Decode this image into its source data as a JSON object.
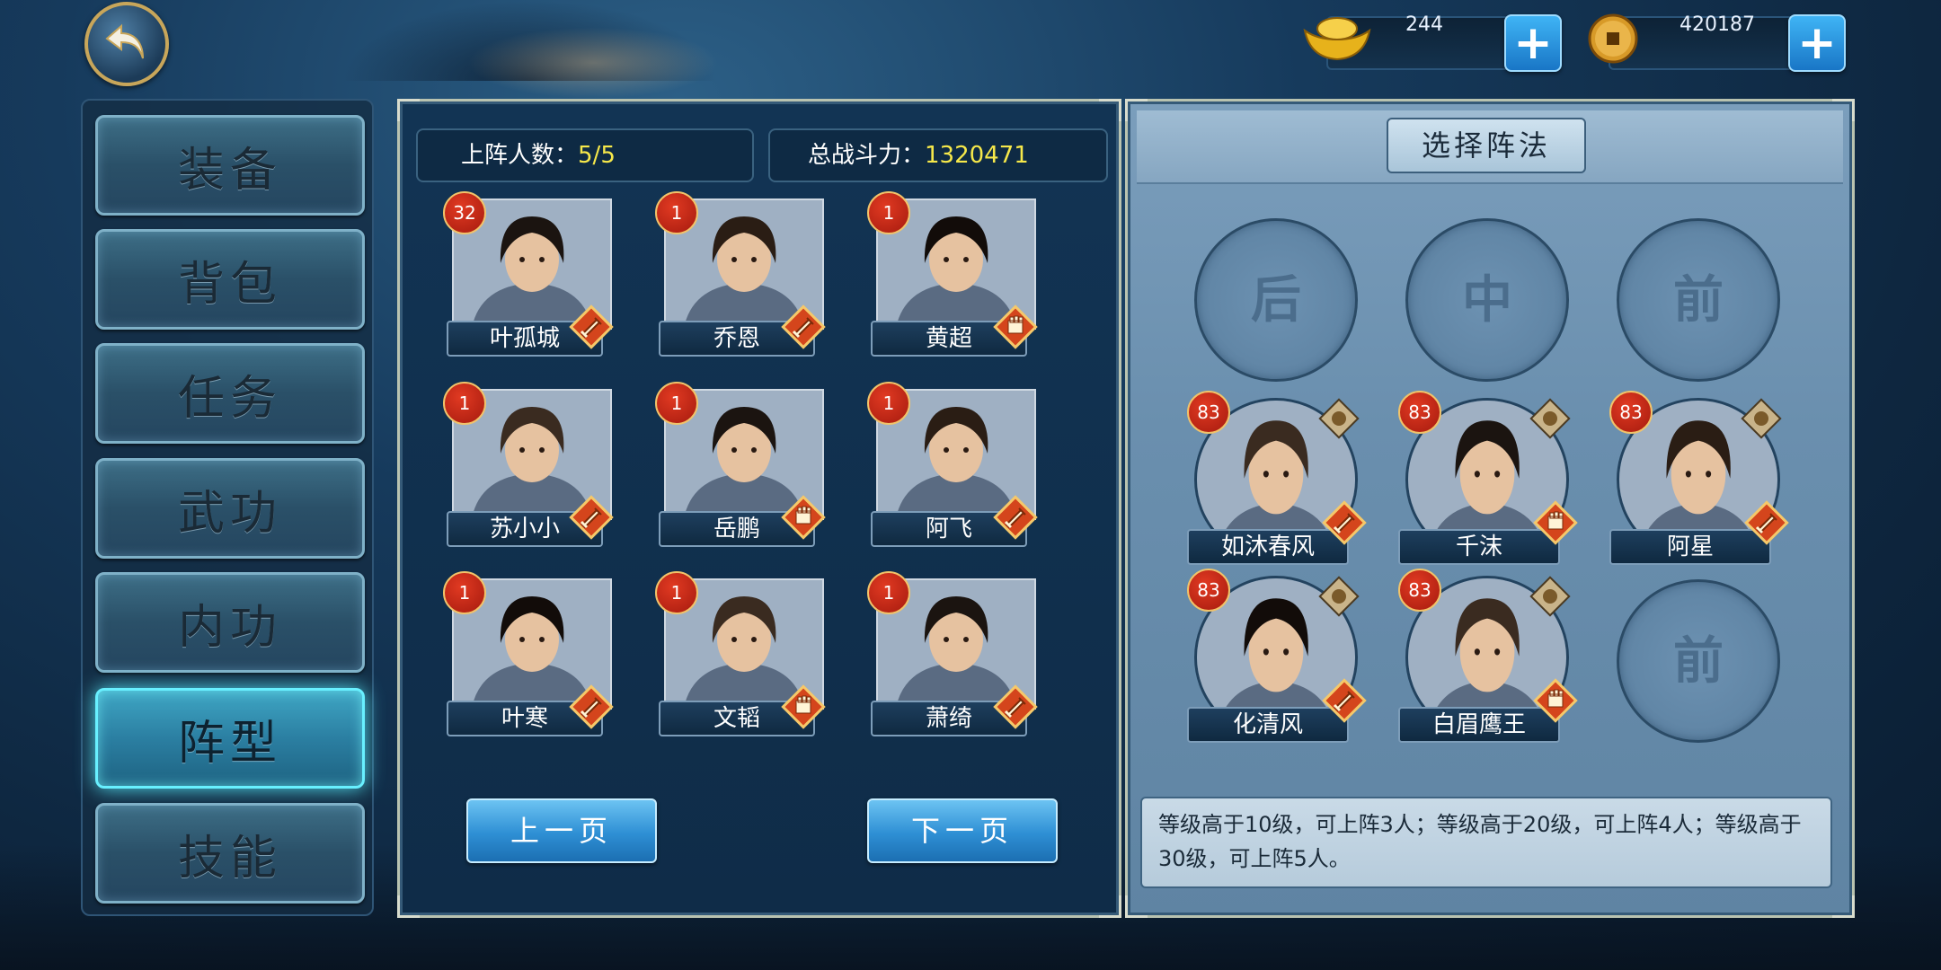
{
  "currency": {
    "gold": "244",
    "copper": "420187"
  },
  "menu": [
    {
      "label": "装备",
      "active": false
    },
    {
      "label": "背包",
      "active": false
    },
    {
      "label": "任务",
      "active": false
    },
    {
      "label": "武功",
      "active": false
    },
    {
      "label": "内功",
      "active": false
    },
    {
      "label": "阵型",
      "active": true
    },
    {
      "label": "技能",
      "active": false
    }
  ],
  "roster": {
    "deployed_label": "上阵人数：",
    "deployed_value": "5/5",
    "power_label": "总战斗力：",
    "power_value": "1320471",
    "heroes": [
      {
        "name": "叶孤城",
        "level": "32",
        "type": "sword"
      },
      {
        "name": "乔恩",
        "level": "1",
        "type": "sword"
      },
      {
        "name": "黄超",
        "level": "1",
        "type": "fist"
      },
      {
        "name": "苏小小",
        "level": "1",
        "type": "sword"
      },
      {
        "name": "岳鹏",
        "level": "1",
        "type": "fist"
      },
      {
        "name": "阿飞",
        "level": "1",
        "type": "sword"
      },
      {
        "name": "叶寒",
        "level": "1",
        "type": "sword"
      },
      {
        "name": "文韬",
        "level": "1",
        "type": "fist"
      },
      {
        "name": "萧绮",
        "level": "1",
        "type": "sword"
      }
    ],
    "prev_page": "上一页",
    "next_page": "下一页"
  },
  "formation": {
    "title": "选择阵法",
    "row_labels": [
      "后",
      "中",
      "前"
    ],
    "slots": [
      {
        "name": "如沐春风",
        "level": "83",
        "type": "sword"
      },
      {
        "name": "千沫",
        "level": "83",
        "type": "fist"
      },
      {
        "name": "阿星",
        "level": "83",
        "type": "sword"
      },
      {
        "name": "化清风",
        "level": "83",
        "type": "sword"
      },
      {
        "name": "白眉鹰王",
        "level": "83",
        "type": "fist"
      }
    ],
    "empty_slot_label": "前",
    "description": "等级高于10级，可上阵3人；等级高于20级，可上阵4人；等级高于30级，可上阵5人。"
  },
  "colors": {
    "accent_yellow": "#f6e84a",
    "badge_red": "#c4241a",
    "active_glow": "#68f0ff"
  }
}
